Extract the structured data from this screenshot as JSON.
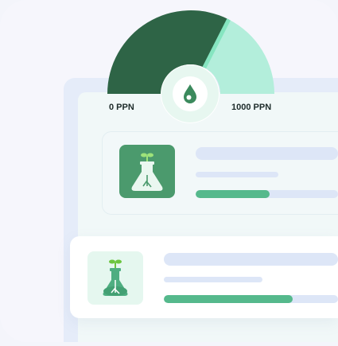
{
  "gauge": {
    "min_label": "0 PPN",
    "max_label": "1000 PPN",
    "level_fraction": 0.65,
    "colors": {
      "filled": "#2e6446",
      "remaining": "#b3eedb",
      "needle": "#85e5c0",
      "center": "#e7f7f0",
      "icon": "#3b8a5d"
    },
    "center_icon": "water-drop-icon"
  },
  "items": [
    {
      "icon": "plant-flask-icon",
      "progress_fraction": 0.52,
      "tile_color": "#4b9a6d"
    },
    {
      "icon": "plant-flask-icon",
      "progress_fraction": 0.74,
      "tile_color": "#e5f7ef"
    }
  ],
  "colors": {
    "progress": "#55b98c",
    "placeholder": "#dde6f7"
  }
}
